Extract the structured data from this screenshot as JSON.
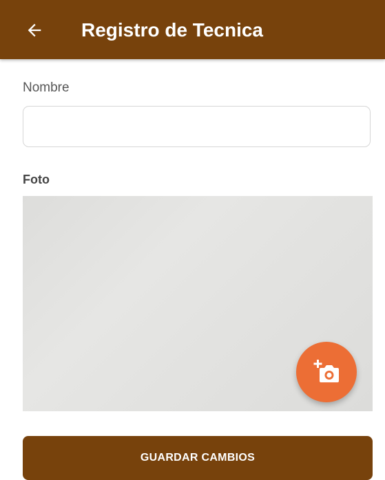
{
  "app_bar": {
    "title": "Registro de Tecnica",
    "back_icon": "arrow-left-icon",
    "color": "#77420c"
  },
  "form": {
    "name_label": "Nombre",
    "name_value": "",
    "photo_label": "Foto",
    "add_photo_icon": "add-photo-camera-icon",
    "fab_color": "#ec6e35",
    "save_label": "GUARDAR CAMBIOS"
  }
}
